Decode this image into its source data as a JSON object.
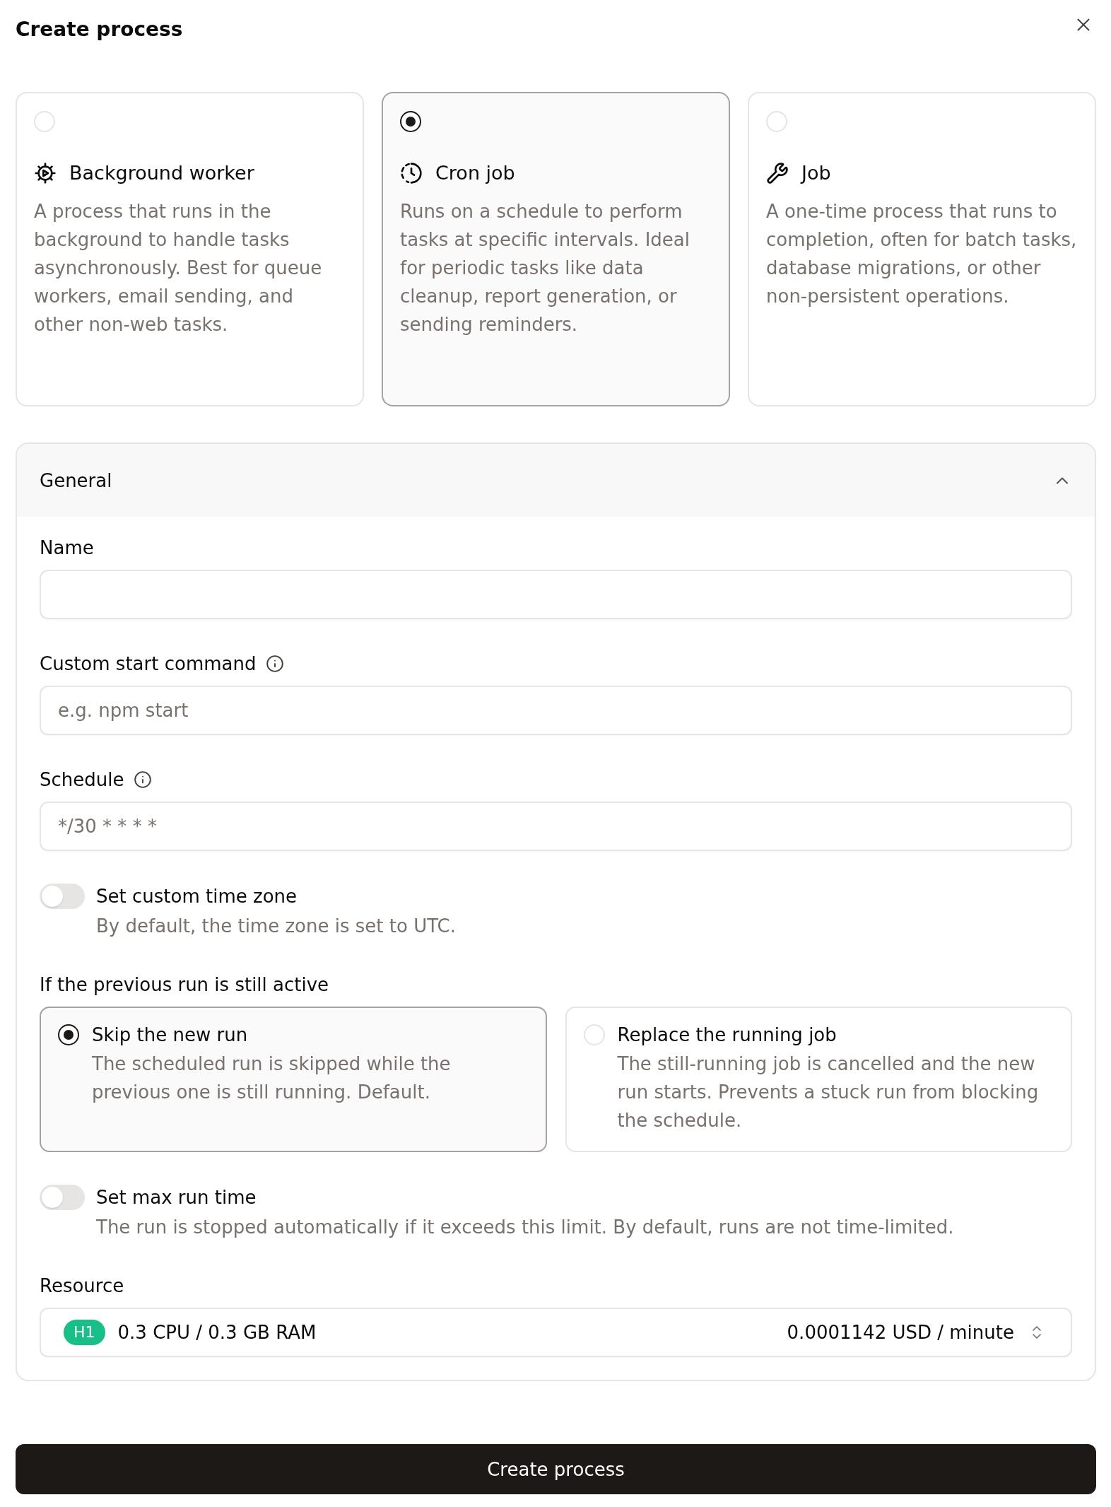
{
  "dialog": {
    "title": "Create process"
  },
  "process_types": [
    {
      "kind": "worker",
      "title": "Background worker",
      "description": "A process that runs in the background to handle tasks asynchronously. Best for queue workers, email sending, and other non-web tasks.",
      "selected": false
    },
    {
      "kind": "cron",
      "title": "Cron job",
      "description": "Runs on a schedule to perform tasks at specific intervals. Ideal for periodic tasks like data cleanup, report generation, or sending reminders.",
      "selected": true
    },
    {
      "kind": "job",
      "title": "Job",
      "description": "A one-time process that runs to completion, often for batch tasks, database migrations, or other non-persistent operations.",
      "selected": false
    }
  ],
  "section": {
    "title": "General",
    "expanded": true,
    "items": [
      {
        "kind": "text_field",
        "label": "Name",
        "info": false
      },
      {
        "kind": "text_field",
        "label": "Custom start command",
        "info": true,
        "placeholder": "e.g. npm start"
      },
      {
        "kind": "text_field",
        "label": "Schedule",
        "info": true,
        "placeholder": "*/30 * * * *"
      },
      {
        "kind": "toggle",
        "label": "Set custom time zone",
        "description": "By default, the time zone is set to UTC.",
        "on": false
      },
      {
        "kind": "choice",
        "label": "If the previous run is still active",
        "options": [
          {
            "title": "Skip the new run",
            "description": "The scheduled run is skipped while the previous one is still running. Default.",
            "selected": true
          },
          {
            "title": "Replace the running job",
            "description": "The still-running job is cancelled and the new run starts. Prevents a stuck run from blocking the schedule.",
            "selected": false
          }
        ]
      },
      {
        "kind": "toggle",
        "label": "Set max run time",
        "description": "The run is stopped automatically if it exceeds this limit. By default, runs are not time-limited.",
        "on": false
      },
      {
        "kind": "select",
        "label": "Resource",
        "badge": "H1",
        "value": "0.3 CPU / 0.3 GB RAM",
        "price": "0.0001142 USD / minute"
      }
    ]
  },
  "submit": {
    "label": "Create process"
  }
}
